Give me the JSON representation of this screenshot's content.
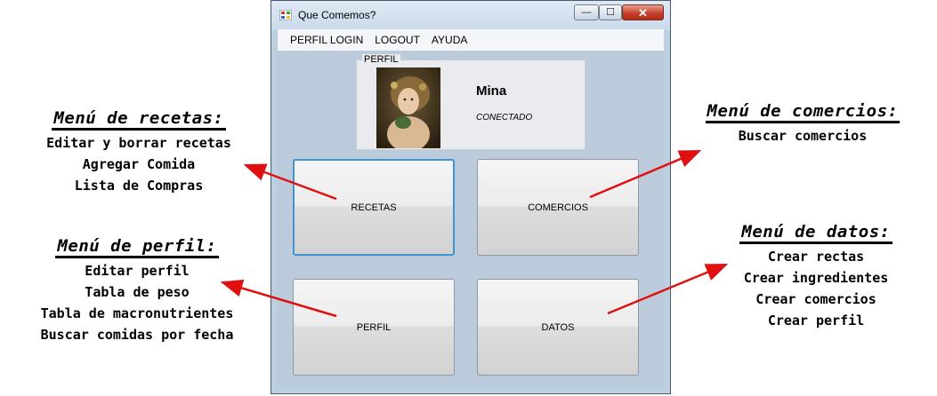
{
  "window": {
    "title": "Que Comemos?",
    "controls": {
      "minimize": "—",
      "maximize": "☐",
      "close": "✕"
    }
  },
  "menu": {
    "items": [
      "PERFIL LOGIN",
      "LOGOUT",
      "AYUDA"
    ]
  },
  "profile": {
    "legend": "PERFIL",
    "name": "Mina",
    "status": "CONECTADO"
  },
  "buttons": {
    "recetas": "RECETAS",
    "comercios": "COMERCIOS",
    "perfil": "PERFIL",
    "datos": "DATOS"
  },
  "annotations": {
    "recetas": {
      "title": "Menú de recetas:",
      "lines": [
        "Editar y borrar recetas",
        "Agregar Comida",
        "Lista de Compras"
      ]
    },
    "perfil": {
      "title": "Menú de perfil:",
      "lines": [
        "Editar perfil",
        "Tabla de peso",
        "Tabla de macronutrientes",
        "Buscar comidas por fecha"
      ]
    },
    "comercios": {
      "title": "Menú de comercios:",
      "lines": [
        "Buscar comercios"
      ]
    },
    "datos": {
      "title": "Menú de datos:",
      "lines": [
        "Crear rectas",
        "Crear ingredientes",
        "Crear comercios",
        "Crear perfil"
      ]
    }
  },
  "colors": {
    "arrow": "#e01010",
    "focus_border": "#3d95d4",
    "close_button": "#c6412c"
  }
}
